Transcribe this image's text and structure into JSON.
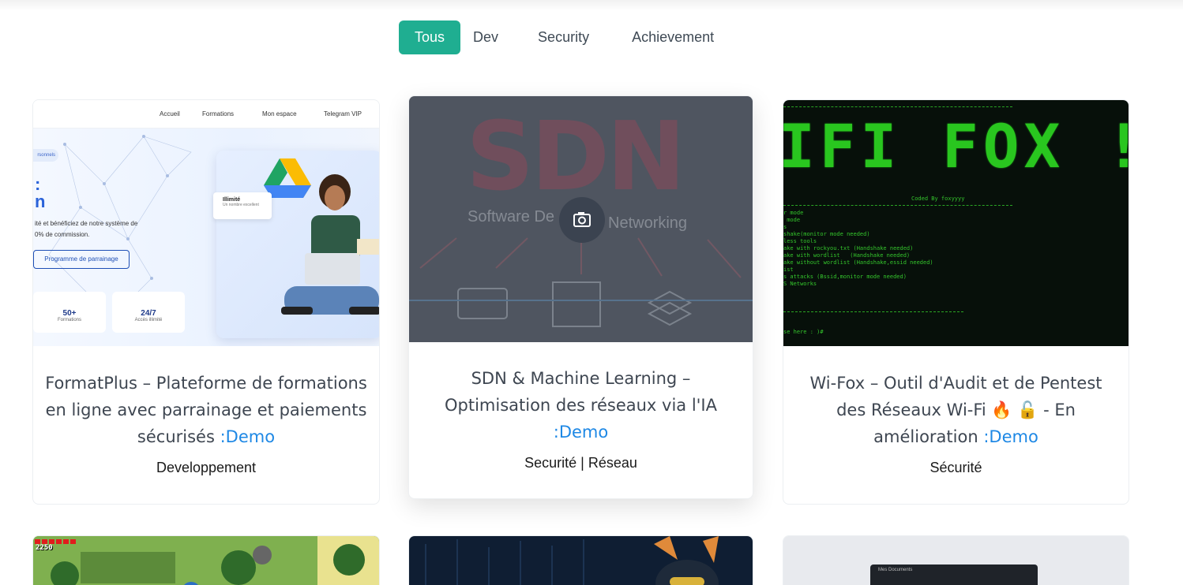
{
  "filters": [
    {
      "label": "Tous",
      "active": true
    },
    {
      "label": "Dev",
      "active": false
    },
    {
      "label": "Security",
      "active": false
    },
    {
      "label": "Achievement",
      "active": false
    }
  ],
  "colors": {
    "accent": "#1fae91",
    "link": "#1e88e5"
  },
  "projects": [
    {
      "title": "FormatPlus – Plateforme de formations en ligne avec parrainage et paiements sécurisés",
      "demo_label": ":Demo",
      "category": "Developpement",
      "thumbnail": {
        "nav": [
          "Accueil",
          "Formations",
          "Mon espace",
          "Telegram VIP"
        ],
        "pill": "rsonnels",
        "big_text_1": ":",
        "big_text_2": "n",
        "line_1": "ité et bénéficiez de notre système de",
        "line_2": "0% de commission.",
        "button": "Programme de parrainage",
        "stats": [
          {
            "value": "50+",
            "label": "Formations"
          },
          {
            "value": "24/7",
            "label": "Accès illimité"
          }
        ],
        "badge_title": "Illimité",
        "badge_sub": "Un nombre excellent"
      }
    },
    {
      "title": "SDN & Machine Learning – Optimisation des réseaux via l'IA",
      "demo_label": ":Demo",
      "category": "Securité | Réseau",
      "thumbnail": {
        "big": "SDN",
        "sub_left": "Software De",
        "sub_right": "Networking",
        "icon": "camera-icon"
      }
    },
    {
      "title": "Wi-Fox – Outil d'Audit et de Pentest des Réseaux Wi-Fi 🔥 🔓 - En amélioration",
      "demo_label": ":Demo",
      "category": "Sécurité",
      "thumbnail": {
        "banner": "IFI FOX !!",
        "coded_by": "Coded By foxyyyy",
        "menu": "r mode\n mode\ns\nshake(monitor mode needed)\nless tools\nake with rockyou.txt (Handshake needed)\nake with wordlist   (Handshake needed)\nake without wordlist (Handshake,essid needed)\nist\ns attacks (Bssid,monitor mode needed)\nS Networks",
        "prompt": "se here : )#"
      }
    }
  ],
  "bottom_row": [
    {
      "hud": "2250"
    },
    {},
    {
      "window_title": "Mes Documents"
    }
  ]
}
